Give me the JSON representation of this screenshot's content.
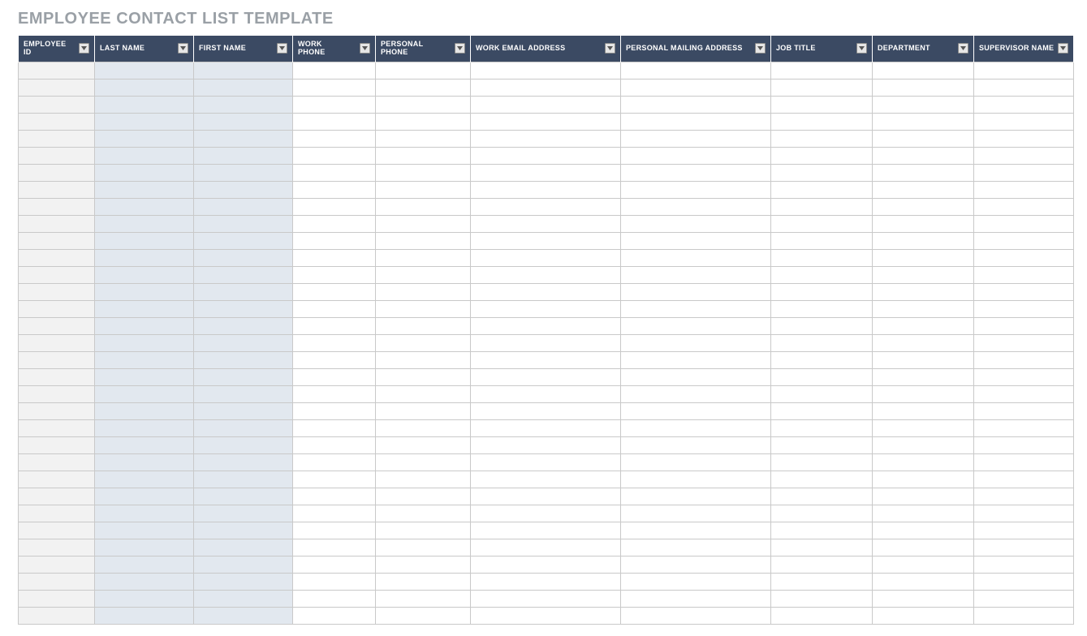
{
  "title": "EMPLOYEE CONTACT LIST TEMPLATE",
  "columns": [
    "EMPLOYEE ID",
    "LAST NAME",
    "FIRST NAME",
    "WORK PHONE",
    "PERSONAL PHONE",
    "WORK EMAIL ADDRESS",
    "PERSONAL MAILING ADDRESS",
    "JOB TITLE",
    "DEPARTMENT",
    "SUPERVISOR NAME"
  ],
  "row_count": 33
}
